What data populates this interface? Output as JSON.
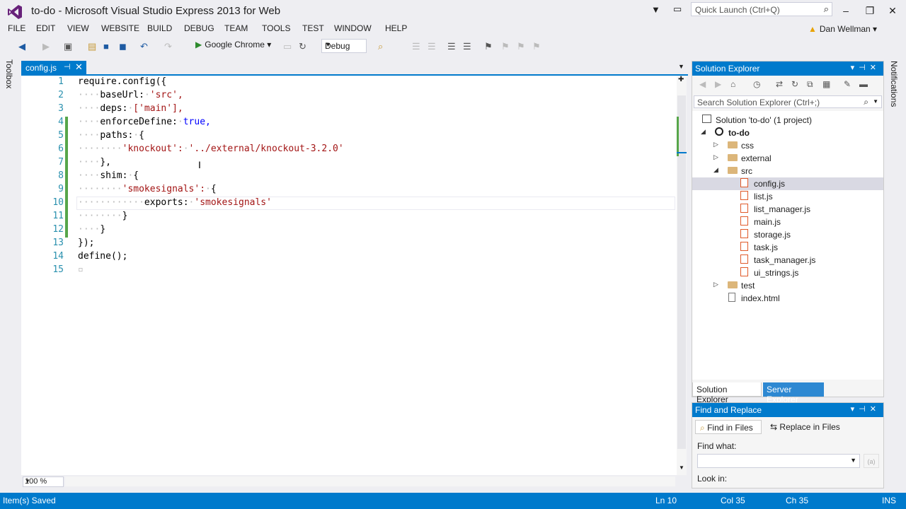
{
  "window": {
    "title": "to-do - Microsoft Visual Studio Express 2013 for Web",
    "quick_launch_placeholder": "Quick Launch (Ctrl+Q)",
    "user_name": "Dan Wellman"
  },
  "menu": [
    "FILE",
    "EDIT",
    "VIEW",
    "WEBSITE",
    "BUILD",
    "DEBUG",
    "TEAM",
    "TOOLS",
    "TEST",
    "WINDOW",
    "HELP"
  ],
  "toolbar": {
    "run_target": "Google Chrome",
    "configuration": "Debug"
  },
  "toolbox_label": "Toolbox",
  "notifications_label": "Notifications",
  "editor": {
    "tab_title": "config.js",
    "zoom": "100 %",
    "line_numbers": [
      "1",
      "2",
      "3",
      "4",
      "5",
      "6",
      "7",
      "8",
      "9",
      "10",
      "11",
      "12",
      "13",
      "14",
      "15"
    ],
    "code_plain": {
      "l1": "require.config({",
      "l13": "});",
      "l14": "define();"
    },
    "tokens": {
      "baseUrl": "baseUrl:",
      "src": "'src',",
      "deps": "deps:",
      "main": "['main'],",
      "enforceDefine": "enforceDefine:",
      "true": "true,",
      "paths": "paths:",
      "brace_open": "{",
      "knockout_key": "'knockout':",
      "knockout_val": "'../external/knockout-3.2.0'",
      "close_comma": "},",
      "shim": "shim:",
      "smoke_key": "'smokesignals':",
      "exports": "exports:",
      "smoke_val": "'smokesignals'",
      "close": "}"
    }
  },
  "solution_explorer": {
    "title": "Solution Explorer",
    "search_placeholder": "Search Solution Explorer (Ctrl+;)",
    "solution": "Solution 'to-do' (1 project)",
    "project": "to-do",
    "folders": [
      "css",
      "external",
      "src",
      "test"
    ],
    "src_files": [
      "config.js",
      "list.js",
      "list_manager.js",
      "main.js",
      "storage.js",
      "task.js",
      "task_manager.js",
      "ui_strings.js"
    ],
    "root_file": "index.html",
    "tabs": [
      "Solution Explorer",
      "Server Explorer"
    ]
  },
  "find_replace": {
    "title": "Find and Replace",
    "tabs": [
      "Find in Files",
      "Replace in Files"
    ],
    "find_label": "Find what:",
    "look_in_label": "Look in:"
  },
  "status": {
    "message": "Item(s) Saved",
    "line": "Ln 10",
    "col": "Col 35",
    "ch": "Ch 35",
    "mode": "INS"
  },
  "colors": {
    "accent": "#007acc",
    "change_marker": "#57a64a",
    "string": "#a31515",
    "keyword": "#0000ff",
    "line_number": "#2b91af"
  }
}
